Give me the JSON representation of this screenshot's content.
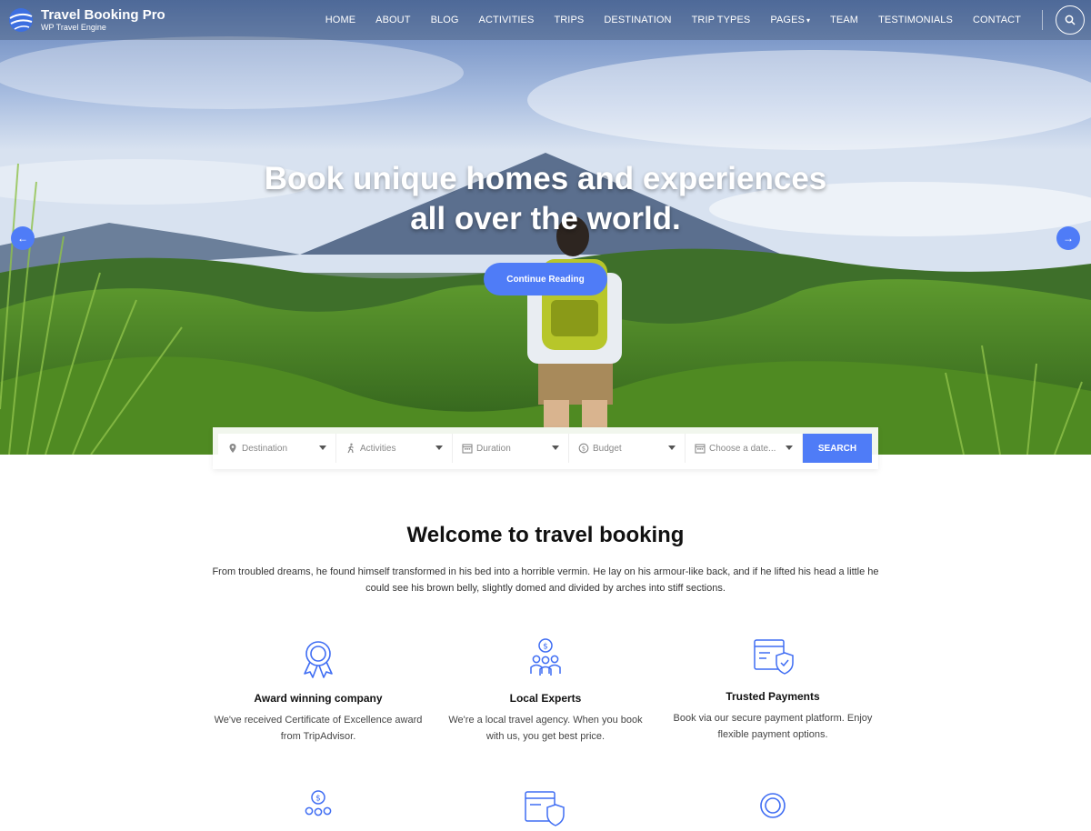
{
  "brand": {
    "name": "Travel Booking Pro",
    "tagline": "WP Travel Engine"
  },
  "nav": {
    "items": [
      "HOME",
      "ABOUT",
      "BLOG",
      "ACTIVITIES",
      "TRIPS",
      "DESTINATION",
      "TRIP TYPES",
      "PAGES",
      "TEAM",
      "TESTIMONIALS",
      "CONTACT"
    ],
    "pages_caret": "▾"
  },
  "hero": {
    "title_line1": "Book unique homes and experiences",
    "title_line2": "all over the world.",
    "cta_label": "Continue Reading",
    "prev_arrow": "←",
    "next_arrow": "→"
  },
  "search": {
    "destination": "Destination",
    "activities": "Activities",
    "duration": "Duration",
    "budget": "Budget",
    "date_placeholder": "Choose a date...",
    "submit_label": "SEARCH"
  },
  "welcome": {
    "title": "Welcome to travel booking",
    "text_line1": "From troubled dreams, he found himself transformed in his bed into a horrible vermin. He lay on his armour-like back, and if he lifted his head a little he",
    "text_line2": "could see his brown belly, slightly domed and divided by arches into stiff sections."
  },
  "features": [
    {
      "title": "Award winning company",
      "desc_line1": "We've received Certificate of Excellence award",
      "desc_line2": "from TripAdvisor."
    },
    {
      "title": "Local Experts",
      "desc_line1": "We're a local travel agency. When you book",
      "desc_line2": "with us, you get best price."
    },
    {
      "title": "Trusted Payments",
      "desc_line1": "Book via our secure payment platform. Enjoy",
      "desc_line2": "flexible payment options."
    }
  ],
  "colors": {
    "accent": "#4f7cf7",
    "icon_stroke": "#3f6df3"
  }
}
